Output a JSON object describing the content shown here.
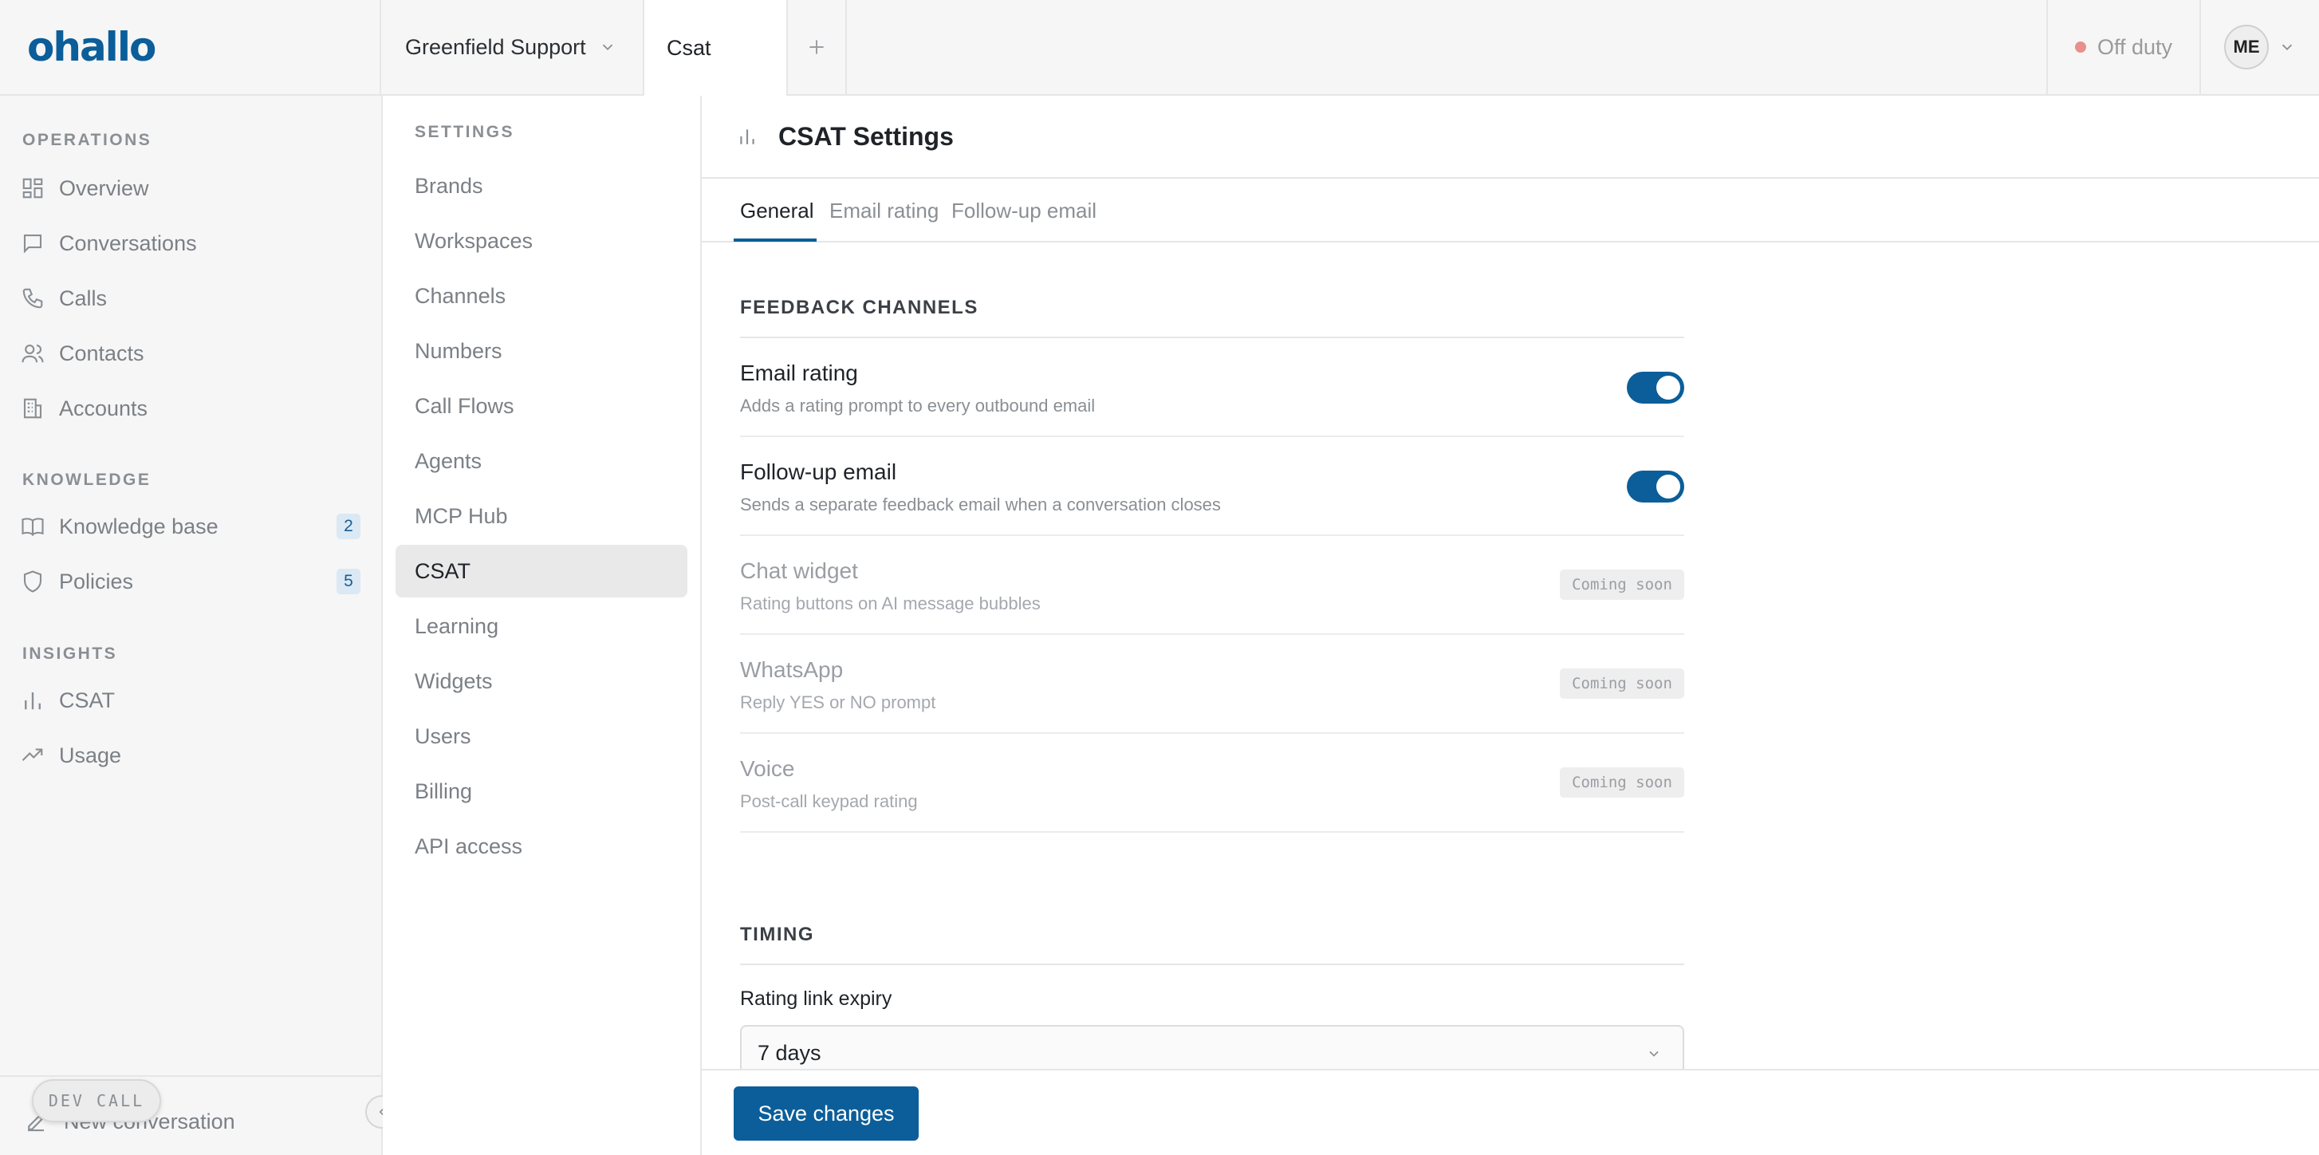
{
  "app": {
    "logo_text": "ohallo",
    "brand_color": "#0b5e99"
  },
  "topbar": {
    "workspace": "Greenfield Support",
    "active_tab": "Csat",
    "status": "Off duty",
    "status_color": "#e8908a",
    "user_initials": "ME"
  },
  "sidebar": {
    "sections": [
      {
        "label": "OPERATIONS",
        "items": [
          {
            "label": "Overview",
            "icon": "grid-icon"
          },
          {
            "label": "Conversations",
            "icon": "chat-icon"
          },
          {
            "label": "Calls",
            "icon": "phone-icon"
          },
          {
            "label": "Contacts",
            "icon": "users-icon"
          },
          {
            "label": "Accounts",
            "icon": "building-icon"
          }
        ]
      },
      {
        "label": "KNOWLEDGE",
        "items": [
          {
            "label": "Knowledge base",
            "icon": "book-icon",
            "badge": "2"
          },
          {
            "label": "Policies",
            "icon": "shield-icon",
            "badge": "5"
          }
        ]
      },
      {
        "label": "INSIGHTS",
        "items": [
          {
            "label": "CSAT",
            "icon": "bar-chart-icon"
          },
          {
            "label": "Usage",
            "icon": "trend-icon"
          }
        ]
      }
    ],
    "new_conversation": "New conversation",
    "dev_call": "DEV CALL"
  },
  "settings": {
    "label": "SETTINGS",
    "items": [
      "Brands",
      "Workspaces",
      "Channels",
      "Numbers",
      "Call Flows",
      "Agents",
      "MCP Hub",
      "CSAT",
      "Learning",
      "Widgets",
      "Users",
      "Billing",
      "API access"
    ],
    "active": "CSAT"
  },
  "main": {
    "title": "CSAT Settings",
    "tabs": [
      "General",
      "Email rating",
      "Follow-up email"
    ],
    "active_tab": "General",
    "feedback_section": "FEEDBACK CHANNELS",
    "channels": [
      {
        "title": "Email rating",
        "desc": "Adds a rating prompt to every outbound email",
        "enabled": true
      },
      {
        "title": "Follow-up email",
        "desc": "Sends a separate feedback email when a conversation closes",
        "enabled": true
      },
      {
        "title": "Chat widget",
        "desc": "Rating buttons on AI message bubbles",
        "badge": "Coming soon"
      },
      {
        "title": "WhatsApp",
        "desc": "Reply YES or NO prompt",
        "badge": "Coming soon"
      },
      {
        "title": "Voice",
        "desc": "Post-call keypad rating",
        "badge": "Coming soon"
      }
    ],
    "timing_section": "TIMING",
    "expiry_label": "Rating link expiry",
    "expiry_value": "7 days",
    "save_label": "Save changes"
  }
}
